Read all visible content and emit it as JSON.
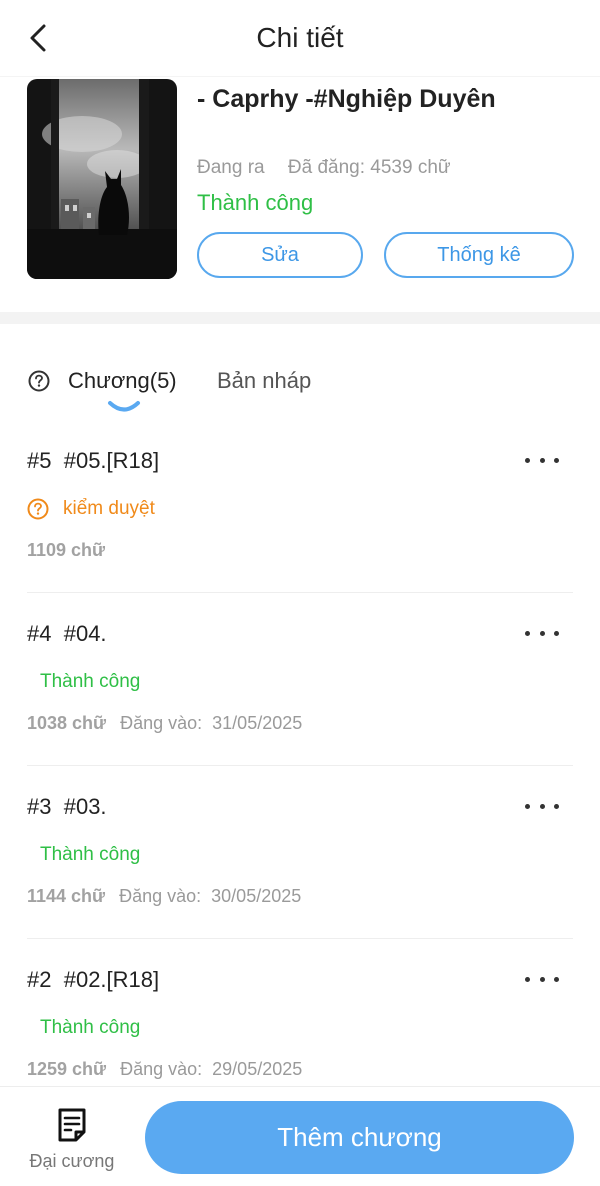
{
  "header": {
    "title": "Chi tiết"
  },
  "book": {
    "title": "- Caprhy -#Nghiệp Duyên",
    "state": "Đang ra",
    "word_count": "Đã đăng: 4539 chữ",
    "status": "Thành công",
    "edit_label": "Sửa",
    "stats_label": "Thống kê"
  },
  "tabs": {
    "chapters": "Chương(5)",
    "drafts": "Bản nháp"
  },
  "chapters": [
    {
      "number": "#5",
      "title": "#05.[R18]",
      "status": "kiểm duyệt",
      "words": "1109 chữ",
      "date_label": "",
      "date": ""
    },
    {
      "number": "#4",
      "title": "#04.",
      "status": "Thành công",
      "words": "1038 chữ",
      "date_label": "Đăng vào:",
      "date": "31/05/2025"
    },
    {
      "number": "#3",
      "title": "#03.",
      "status": "Thành công",
      "words": "1144 chữ",
      "date_label": "Đăng vào:",
      "date": "30/05/2025"
    },
    {
      "number": "#2",
      "title": "#02.[R18]",
      "status": "Thành công",
      "words": "1259 chữ",
      "date_label": "Đăng vào:",
      "date": "29/05/2025"
    }
  ],
  "bottom": {
    "outline_label": "Đại cương",
    "add_chapter_label": "Thêm chương"
  },
  "colors": {
    "accent": "#5aa9f1",
    "success": "#2fbf46",
    "warning": "#f08a1a"
  }
}
